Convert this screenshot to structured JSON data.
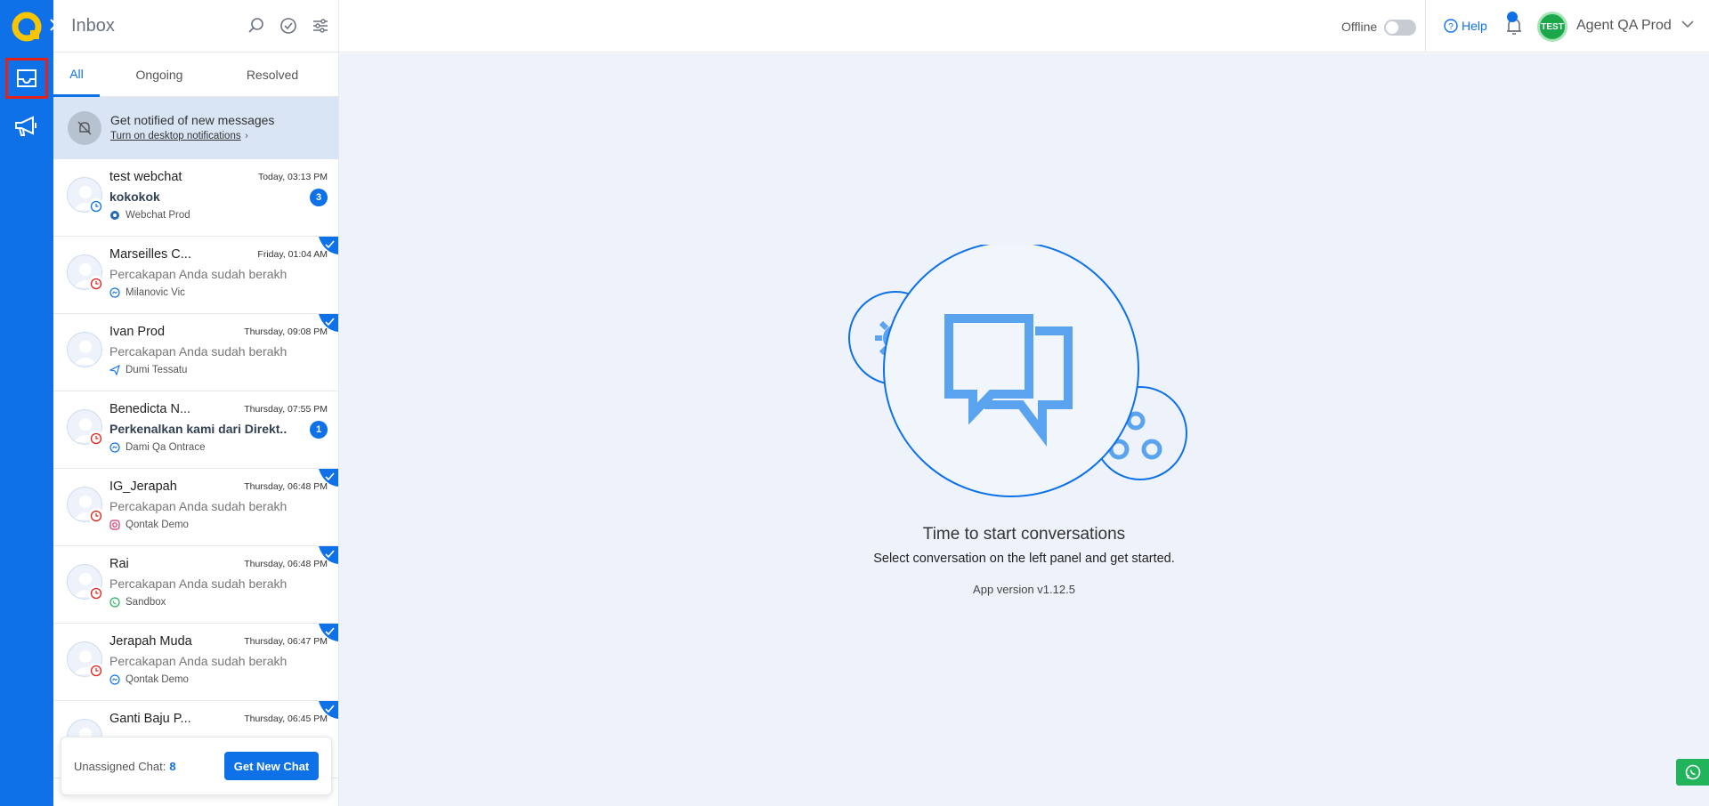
{
  "sidebar": {
    "items": [
      {
        "icon": "inbox-icon",
        "active": true
      },
      {
        "icon": "megaphone-icon",
        "active": false
      }
    ]
  },
  "inbox": {
    "title": "Inbox",
    "tabs": [
      {
        "label": "All",
        "active": true
      },
      {
        "label": "Ongoing",
        "active": false
      },
      {
        "label": "Resolved",
        "active": false
      }
    ],
    "notification": {
      "title": "Get notified of new messages",
      "link": "Turn on desktop notifications"
    },
    "conversations": [
      {
        "name": "test webchat",
        "time": "Today, 03:13 PM",
        "message": "kokokok",
        "channel": "Webchat Prod",
        "channel_icon": "webchat-icon",
        "unread": 3,
        "checked": false,
        "status": "pending"
      },
      {
        "name": "Marseilles C...",
        "time": "Friday, 01:04 AM",
        "message": "Percakapan Anda sudah berakhir, t...",
        "channel": "Milanovic Vic",
        "channel_icon": "messenger-icon",
        "unread": null,
        "checked": true,
        "status": "expired"
      },
      {
        "name": "Ivan Prod",
        "time": "Thursday, 09:08 PM",
        "message": "Percakapan Anda sudah berakhir, t...",
        "channel": "Dumi Tessatu",
        "channel_icon": "telegram-icon",
        "unread": null,
        "checked": true,
        "status": "none"
      },
      {
        "name": "Benedicta N...",
        "time": "Thursday, 07:55 PM",
        "message": "Perkenalkan kami dari Direkt...",
        "channel": "Dami Qa Ontrace",
        "channel_icon": "messenger-icon",
        "unread": 1,
        "checked": false,
        "status": "expired"
      },
      {
        "name": "IG_Jerapah",
        "time": "Thursday, 06:48 PM",
        "message": "Percakapan Anda sudah berakhir, t...",
        "channel": "Qontak Demo",
        "channel_icon": "instagram-icon",
        "unread": null,
        "checked": true,
        "status": "expired"
      },
      {
        "name": "Rai",
        "time": "Thursday, 06:48 PM",
        "message": "Percakapan Anda sudah berakhir, t...",
        "channel": "Sandbox",
        "channel_icon": "whatsapp-icon",
        "unread": null,
        "checked": true,
        "status": "expired"
      },
      {
        "name": "Jerapah Muda",
        "time": "Thursday, 06:47 PM",
        "message": "Percakapan Anda sudah berakhir, t...",
        "channel": "Qontak Demo",
        "channel_icon": "messenger-icon",
        "unread": null,
        "checked": true,
        "status": "expired"
      },
      {
        "name": "Ganti Baju P...",
        "time": "Thursday, 06:45 PM",
        "message": "",
        "channel": "",
        "channel_icon": "",
        "unread": null,
        "checked": true,
        "status": "none"
      }
    ],
    "footer": {
      "unassigned_label": "Unassigned Chat:",
      "unassigned_count": "8",
      "button": "Get New Chat"
    }
  },
  "topbar": {
    "status_label": "Offline",
    "help_label": "Help",
    "agent_badge": "TEST",
    "agent_name": "Agent QA Prod"
  },
  "main": {
    "title": "Time to start conversations",
    "subtitle": "Select conversation on the left panel and get started.",
    "app_version": "App version v1.12.5"
  },
  "colors": {
    "primary": "#0f71e8",
    "rail": "#0f71e8",
    "notify_bg": "#d9e5f4",
    "main_bg": "#eef3fb",
    "online_green": "#1aa84b",
    "expired_red": "#e2231a"
  }
}
